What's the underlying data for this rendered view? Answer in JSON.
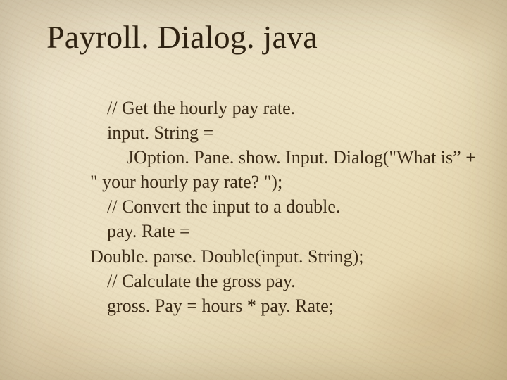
{
  "title": "Payroll. Dialog. java",
  "code": {
    "l1": "// Get the hourly pay rate.",
    "l2": "input. String =",
    "l3": "JOption. Pane. show. Input. Dialog(\"What is” +",
    "l4": "\" your hourly pay rate? \");",
    "l5": "// Convert the input to a double.",
    "l6": "pay. Rate =",
    "l7": "Double. parse. Double(input. String);",
    "l8": "// Calculate the gross pay.",
    "l9": "gross. Pay = hours * pay. Rate;"
  }
}
